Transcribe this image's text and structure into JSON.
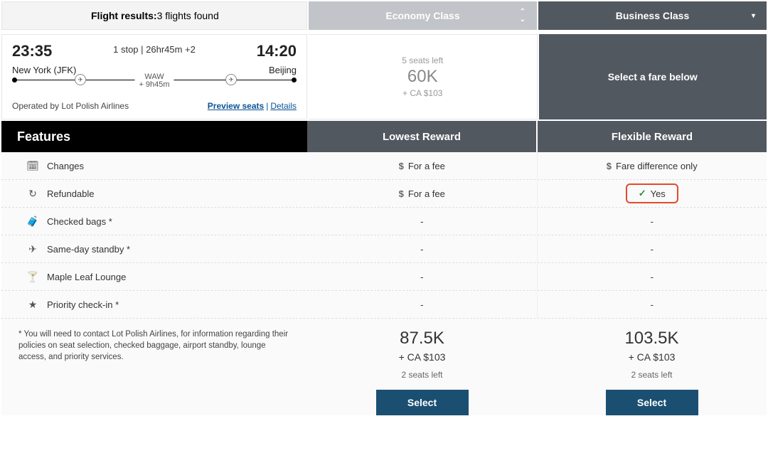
{
  "header": {
    "results_label": "Flight results:",
    "results_count": "3 flights found",
    "economy": "Economy Class",
    "business": "Business Class"
  },
  "flight": {
    "dep_time": "23:35",
    "arr_time": "14:20",
    "stops": "1 stop | 26hr45m +2",
    "from": "New York (JFK)",
    "to": "Beijing",
    "stop_code": "WAW",
    "stop_dur": "+ 9h45m",
    "operated": "Operated by Lot Polish Airlines",
    "preview": "Preview seats",
    "details": "Details"
  },
  "econ_box": {
    "seats": "5 seats left",
    "points": "60K",
    "cash": "+ CA $103"
  },
  "biz_box": {
    "label": "Select a fare below"
  },
  "cols": {
    "features": "Features",
    "lowest": "Lowest Reward",
    "flex": "Flexible Reward"
  },
  "features": {
    "changes": "Changes",
    "refundable": "Refundable",
    "bags": "Checked bags *",
    "standby": "Same-day standby *",
    "lounge": "Maple Leaf Lounge",
    "priority": "Priority check-in *"
  },
  "vals": {
    "fee": "For a fee",
    "diff": "Fare difference only",
    "yes": "Yes",
    "dash": "-"
  },
  "disclaimer": "* You will need to contact Lot Polish Airlines, for information regarding their policies on seat selection, checked baggage, airport standby, lounge access, and priority services.",
  "fares": {
    "lowest": {
      "points": "87.5K",
      "cash": "+ CA $103",
      "seats": "2 seats left",
      "select": "Select"
    },
    "flex": {
      "points": "103.5K",
      "cash": "+ CA $103",
      "seats": "2 seats left",
      "select": "Select"
    }
  }
}
